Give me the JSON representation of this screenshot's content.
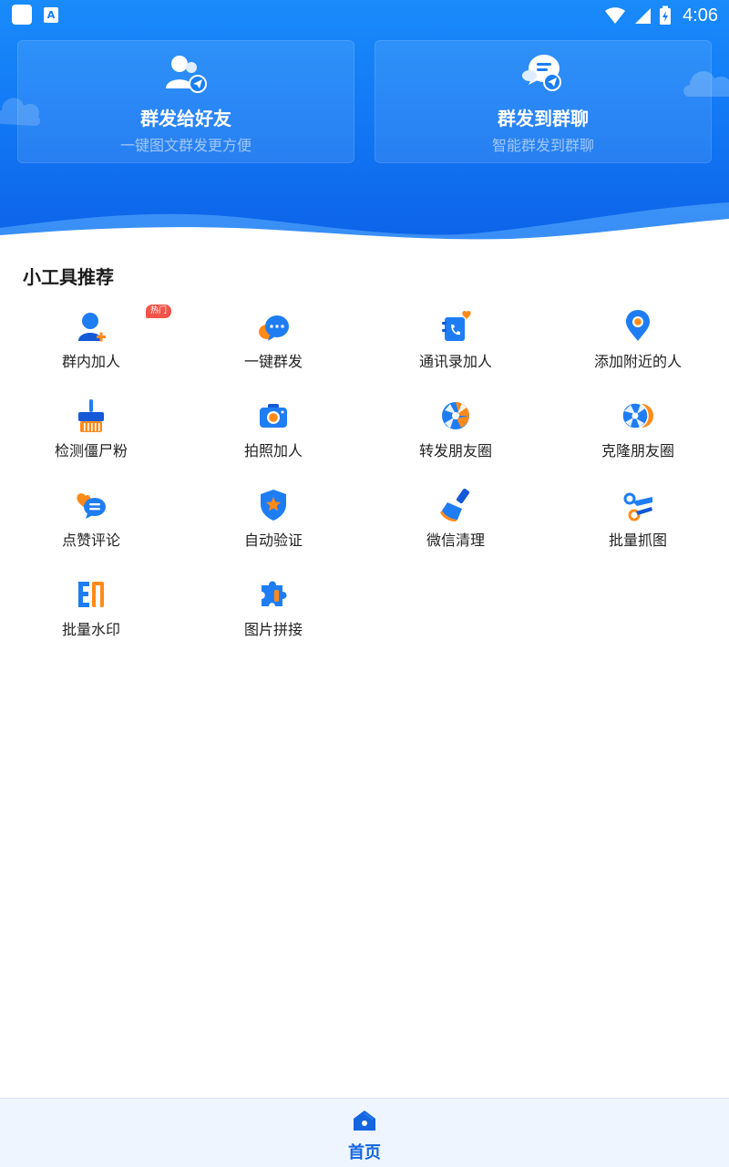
{
  "status_bar": {
    "time": "4:06",
    "notification_icons": [
      "app-square-icon",
      "app-a-icon"
    ],
    "app_a_letter": "A"
  },
  "cards": [
    {
      "title": "群发给好友",
      "subtitle": "一键图文群发更方便",
      "icon": "friends-send-icon"
    },
    {
      "title": "群发到群聊",
      "subtitle": "智能群发到群聊",
      "icon": "group-chat-send-icon"
    }
  ],
  "section_title": "小工具推荐",
  "tools": [
    {
      "label": "群内加人",
      "icon": "add-person-icon",
      "badge": "热门"
    },
    {
      "label": "一键群发",
      "icon": "chat-bubbles-icon"
    },
    {
      "label": "通讯录加人",
      "icon": "contacts-icon"
    },
    {
      "label": "添加附近的人",
      "icon": "location-pin-icon"
    },
    {
      "label": "检测僵尸粉",
      "icon": "broom-icon"
    },
    {
      "label": "拍照加人",
      "icon": "camera-icon"
    },
    {
      "label": "转发朋友圈",
      "icon": "aperture-icon"
    },
    {
      "label": "克隆朋友圈",
      "icon": "aperture-double-icon"
    },
    {
      "label": "点赞评论",
      "icon": "like-comment-icon"
    },
    {
      "label": "自动验证",
      "icon": "shield-star-icon"
    },
    {
      "label": "微信清理",
      "icon": "cleaning-brush-icon"
    },
    {
      "label": "批量抓图",
      "icon": "scissors-icon"
    },
    {
      "label": "批量水印",
      "icon": "watermark-icon"
    },
    {
      "label": "图片拼接",
      "icon": "puzzle-icon"
    }
  ],
  "bottom_nav": {
    "items": [
      {
        "label": "首页",
        "icon": "home-icon",
        "active": true
      }
    ]
  },
  "colors": {
    "primary": "#1279f5",
    "accent_orange": "#ff8a1a",
    "hot_badge": "#f3544a",
    "nav_active": "#1565e0"
  }
}
